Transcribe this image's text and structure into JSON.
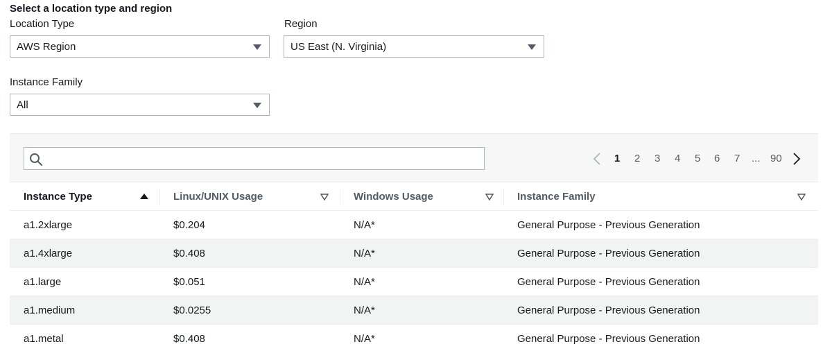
{
  "form": {
    "heading": "Select a location type and region",
    "location_type": {
      "label": "Location Type",
      "value": "AWS Region"
    },
    "region": {
      "label": "Region",
      "value": "US East (N. Virginia)"
    },
    "instance_family": {
      "label": "Instance Family",
      "value": "All"
    }
  },
  "search": {
    "placeholder": ""
  },
  "pagination": {
    "pages": [
      "1",
      "2",
      "3",
      "4",
      "5",
      "6",
      "7",
      "...",
      "90"
    ],
    "current": "1"
  },
  "table": {
    "columns": [
      "Instance Type",
      "Linux/UNIX Usage",
      "Windows Usage",
      "Instance Family"
    ],
    "rows": [
      [
        "a1.2xlarge",
        "$0.204",
        "N/A*",
        "General Purpose - Previous Generation"
      ],
      [
        "a1.4xlarge",
        "$0.408",
        "N/A*",
        "General Purpose - Previous Generation"
      ],
      [
        "a1.large",
        "$0.051",
        "N/A*",
        "General Purpose - Previous Generation"
      ],
      [
        "a1.medium",
        "$0.0255",
        "N/A*",
        "General Purpose - Previous Generation"
      ],
      [
        "a1.metal",
        "$0.408",
        "N/A*",
        "General Purpose - Previous Generation"
      ]
    ]
  },
  "colors": {
    "border": "#aab7b8",
    "text": "#16191f",
    "muted": "#545b64",
    "stripe": "#f2f3f3"
  },
  "icons": {
    "search": "search-icon",
    "prev": "chevron-left-icon",
    "next": "chevron-right-icon"
  }
}
